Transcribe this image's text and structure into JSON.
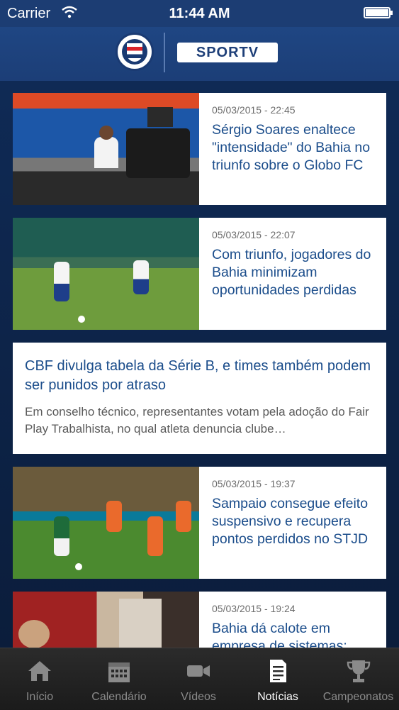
{
  "status_bar": {
    "carrier": "Carrier",
    "time": "11:44 AM"
  },
  "header": {
    "club_logo_icon": "bahia-crest-icon",
    "partner_logo_text": "SPORTV"
  },
  "feed": {
    "items": [
      {
        "type": "image",
        "date": "05/03/2015 - 22:45",
        "title": "Sérgio Soares enaltece \"intensidade\" do Bahia no triunfo sobre o Globo FC",
        "thumb_icon": "press-conference-photo"
      },
      {
        "type": "image",
        "date": "05/03/2015 - 22:07",
        "title": "Com triunfo, jogadores do Bahia minimizam oportunidades perdidas",
        "thumb_icon": "soccer-match-photo"
      },
      {
        "type": "text",
        "title": "CBF divulga tabela da Série B, e times também podem ser punidos por atraso",
        "summary": "Em conselho técnico, representantes votam pela adoção do Fair Play Trabalhista, no qual atleta denuncia clube…"
      },
      {
        "type": "image",
        "date": "05/03/2015 - 19:37",
        "title": "Sampaio consegue efeito suspensivo e recupera pontos perdidos no STJD",
        "thumb_icon": "soccer-match-photo"
      },
      {
        "type": "image",
        "date": "05/03/2015 - 19:24",
        "title": "Bahia dá calote em empresa de sistemas:",
        "thumb_icon": "office-photo"
      }
    ]
  },
  "tab_bar": {
    "tabs": [
      {
        "label": "Início",
        "icon": "home-icon"
      },
      {
        "label": "Calendário",
        "icon": "calendar-icon"
      },
      {
        "label": "Vídeos",
        "icon": "video-camera-icon"
      },
      {
        "label": "Notícias",
        "icon": "news-document-icon",
        "active": true
      },
      {
        "label": "Campeonatos",
        "icon": "trophy-icon"
      }
    ]
  },
  "colors": {
    "header_blue": "#1f4683",
    "link_blue": "#1b4d8b",
    "tab_active": "#ffffff",
    "tab_inactive": "#8a8a8a"
  }
}
